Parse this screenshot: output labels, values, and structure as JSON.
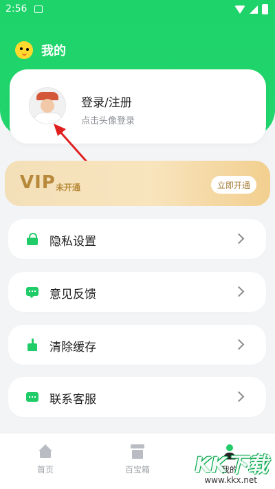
{
  "status_bar": {
    "time": "2:56"
  },
  "header": {
    "title": "我的"
  },
  "profile": {
    "login_title": "登录/注册",
    "login_hint": "点击头像登录"
  },
  "vip": {
    "label": "VIP",
    "status": "未开通",
    "button": "立即开通"
  },
  "menu": {
    "items": [
      {
        "label": "隐私设置",
        "icon": "lock-icon"
      },
      {
        "label": "意见反馈",
        "icon": "chat-icon"
      },
      {
        "label": "清除缓存",
        "icon": "broom-icon"
      },
      {
        "label": "联系客服",
        "icon": "service-icon"
      }
    ]
  },
  "bottom_nav": {
    "items": [
      {
        "label": "首页",
        "icon": "home-icon"
      },
      {
        "label": "百宝箱",
        "icon": "box-icon"
      },
      {
        "label": "我的",
        "icon": "me-icon",
        "active": true
      }
    ]
  },
  "watermark": {
    "text": "KK下载",
    "url": "www.kkx.net"
  },
  "colors": {
    "primary": "#1fcc67",
    "vip_gold": "#b8893b",
    "arrow": "#e02020"
  }
}
